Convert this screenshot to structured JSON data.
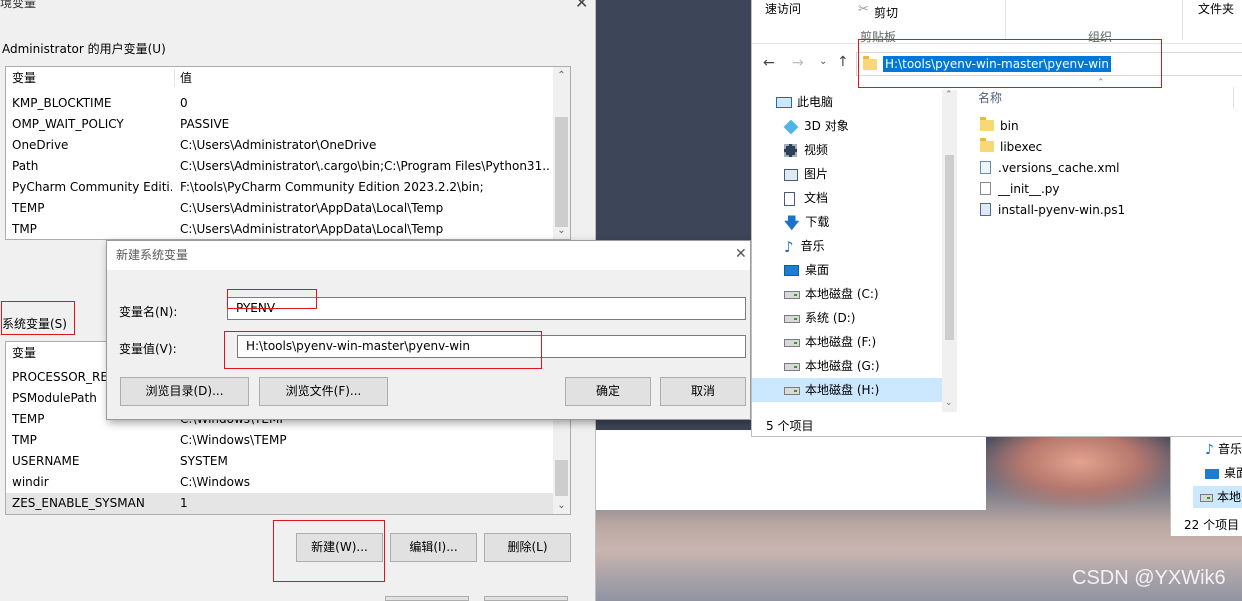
{
  "env_window": {
    "title_fragment": "境变量",
    "user_section_label": "Administrator 的用户变量(U)",
    "user_headers": [
      "变量",
      "值"
    ],
    "user_vars": [
      {
        "name": "KMP_BLOCKTIME",
        "value": "0"
      },
      {
        "name": "OMP_WAIT_POLICY",
        "value": "PASSIVE"
      },
      {
        "name": "OneDrive",
        "value": "C:\\Users\\Administrator\\OneDrive"
      },
      {
        "name": "Path",
        "value": "C:\\Users\\Administrator\\.cargo\\bin;C:\\Program Files\\Python31..."
      },
      {
        "name": "PyCharm Community Editi...",
        "value": "F:\\tools\\PyCharm Community Edition 2023.2.2\\bin;"
      },
      {
        "name": "TEMP",
        "value": "C:\\Users\\Administrator\\AppData\\Local\\Temp"
      },
      {
        "name": "TMP",
        "value": "C:\\Users\\Administrator\\AppData\\Local\\Temp"
      }
    ],
    "system_section_label": "系统变量(S)",
    "system_headers": [
      "变量",
      "值"
    ],
    "system_vars": [
      {
        "name": "PROCESSOR_REV",
        "value": ""
      },
      {
        "name": "PSModulePath",
        "value": ""
      },
      {
        "name": "TEMP",
        "value": "C:\\Windows\\TEMP"
      },
      {
        "name": "TMP",
        "value": "C:\\Windows\\TEMP"
      },
      {
        "name": "USERNAME",
        "value": "SYSTEM"
      },
      {
        "name": "windir",
        "value": "C:\\Windows"
      },
      {
        "name": "ZES_ENABLE_SYSMAN",
        "value": "1"
      }
    ],
    "buttons": {
      "new": "新建(W)...",
      "edit": "编辑(I)...",
      "delete": "删除(L)"
    }
  },
  "new_var_dialog": {
    "title": "新建系统变量",
    "name_label": "变量名(N):",
    "name_value": "PYENV",
    "value_label": "变量值(V):",
    "value_value": "H:\\tools\\pyenv-win-master\\pyenv-win",
    "browse_dir": "浏览目录(D)...",
    "browse_file": "浏览文件(F)...",
    "ok": "确定",
    "cancel": "取消"
  },
  "explorer": {
    "ribbon": {
      "access": "速访问",
      "cut": "剪切",
      "clipboard": "剪贴板",
      "organize": "组织",
      "folder_frag": "文件夹"
    },
    "address": "H:\\tools\\pyenv-win-master\\pyenv-win",
    "column_name": "名称",
    "nav": [
      {
        "label": "此电脑",
        "icon": "computer-icon"
      },
      {
        "label": "3D 对象",
        "icon": "cube-icon"
      },
      {
        "label": "视频",
        "icon": "video-icon"
      },
      {
        "label": "图片",
        "icon": "picture-icon"
      },
      {
        "label": "文档",
        "icon": "document-icon"
      },
      {
        "label": "下载",
        "icon": "download-icon"
      },
      {
        "label": "音乐",
        "icon": "music-icon"
      },
      {
        "label": "桌面",
        "icon": "desktop-icon"
      },
      {
        "label": "本地磁盘 (C:)",
        "icon": "drive-icon"
      },
      {
        "label": "系统 (D:)",
        "icon": "drive-icon"
      },
      {
        "label": "本地磁盘 (F:)",
        "icon": "drive-icon"
      },
      {
        "label": "本地磁盘 (G:)",
        "icon": "drive-icon"
      },
      {
        "label": "本地磁盘 (H:)",
        "icon": "drive-icon"
      }
    ],
    "files": [
      {
        "name": "bin",
        "type": "folder"
      },
      {
        "name": "libexec",
        "type": "folder"
      },
      {
        "name": ".versions_cache.xml",
        "type": "xml"
      },
      {
        "name": "__init__.py",
        "type": "py"
      },
      {
        "name": "install-pyenv-win.ps1",
        "type": "ps1"
      }
    ],
    "status": "5 个项目"
  },
  "explorer2": {
    "nav": [
      "音乐",
      "桌面",
      "本地"
    ],
    "status": "22 个项目"
  },
  "watermark": "CSDN @YXWik6"
}
